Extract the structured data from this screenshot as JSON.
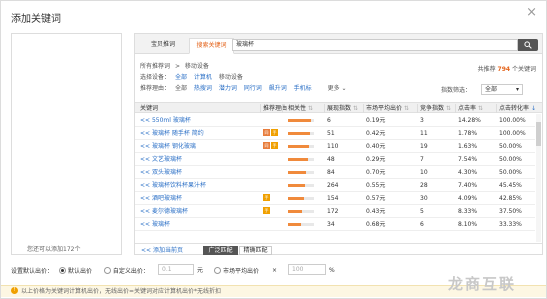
{
  "dialog": {
    "title": "添加关键词",
    "close": "×"
  },
  "left": {
    "hint": "您还可以添加172个"
  },
  "tabs": [
    {
      "label": "宝贝推词"
    },
    {
      "label": "搜索关键词"
    }
  ],
  "search": {
    "value": "玻璃杯"
  },
  "filters": {
    "category_label": "所有推荐词",
    "category_sep": ">",
    "category_value": "移动设备",
    "device_label": "选择设备：",
    "device_options": [
      "全部",
      "计算机",
      "移动设备"
    ],
    "reason_label": "推荐理由：",
    "reason_options": [
      "全部",
      "热搜词",
      "潜力词",
      "同行词",
      "飙升词",
      "手机标"
    ],
    "more": "更多",
    "total_prefix": "共推荐",
    "total_count": "794",
    "total_suffix": "个关键词",
    "index_label": "指数筛选：",
    "index_value": "全部"
  },
  "columns": [
    "关键词",
    "推荐理由",
    "相关性",
    "展现指数",
    "市场平均出价",
    "竞争指数",
    "点击率",
    "点击转化率"
  ],
  "add_text": "<<",
  "rows": [
    {
      "keyword": "550ml 玻璃杯",
      "tags": [],
      "rel": 0.9,
      "show": "6",
      "price": "0.19元",
      "comp": "3",
      "ctr": "14.28%",
      "cvr": "100.00%"
    },
    {
      "keyword": "玻璃杯 随手杯 简约",
      "tags": [
        "同",
        "手"
      ],
      "rel": 0.85,
      "show": "51",
      "price": "0.42元",
      "comp": "11",
      "ctr": "1.78%",
      "cvr": "100.00%"
    },
    {
      "keyword": "玻璃杯 钢化玻璃",
      "tags": [
        "同",
        "手"
      ],
      "rel": 0.8,
      "show": "110",
      "price": "0.40元",
      "comp": "19",
      "ctr": "1.63%",
      "cvr": "50.00%"
    },
    {
      "keyword": "文艺玻璃杯",
      "tags": [],
      "rel": 0.75,
      "show": "48",
      "price": "0.29元",
      "comp": "7",
      "ctr": "7.54%",
      "cvr": "50.00%"
    },
    {
      "keyword": "双头玻璃杯",
      "tags": [],
      "rel": 0.7,
      "show": "84",
      "price": "0.70元",
      "comp": "10",
      "ctr": "4.30%",
      "cvr": "50.00%"
    },
    {
      "keyword": "玻璃杯饮料杯果汁杯",
      "tags": [],
      "rel": 0.65,
      "show": "264",
      "price": "0.55元",
      "comp": "28",
      "ctr": "7.40%",
      "cvr": "45.45%"
    },
    {
      "keyword": "酒吧玻璃杯",
      "tags": [
        "手"
      ],
      "rel": 0.6,
      "show": "154",
      "price": "0.57元",
      "comp": "30",
      "ctr": "4.09%",
      "cvr": "42.85%"
    },
    {
      "keyword": "麦尔德玻璃杯",
      "tags": [
        "手"
      ],
      "rel": 0.55,
      "show": "172",
      "price": "0.43元",
      "comp": "5",
      "ctr": "8.33%",
      "cvr": "37.50%"
    },
    {
      "keyword": "玻璃杯",
      "tags": [],
      "rel": 0.5,
      "show": "34",
      "price": "0.68元",
      "comp": "6",
      "ctr": "8.10%",
      "cvr": "33.33%"
    }
  ],
  "footer": {
    "add_current": "<< 添加当前页",
    "broad": "广泛匹配",
    "exact": "精确匹配"
  },
  "bid": {
    "label": "设置默认出价：",
    "default_label": "默认出价",
    "custom_label": "自定义出价：",
    "custom_placeholder": "0.1",
    "unit": "元",
    "market_label": "市场平均出价",
    "times": "×",
    "percent_value": "100",
    "percent_unit": "%"
  },
  "notice": {
    "icon": "!",
    "text": "以上价格为关键词计算机出价，无线出价=关键词对应计算机出价*无线折扣"
  },
  "watermark": "龙商互联"
}
